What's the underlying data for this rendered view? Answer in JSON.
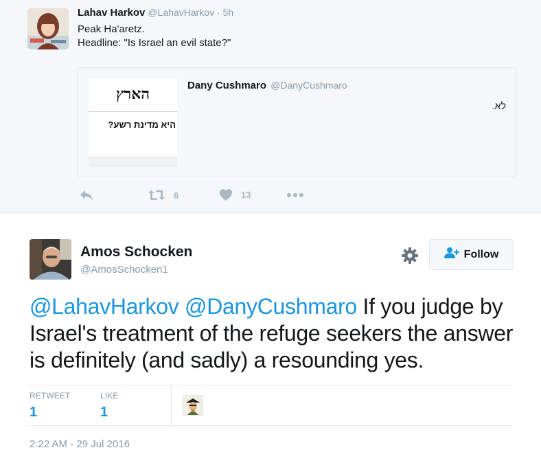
{
  "parent_tweet": {
    "author_name": "Lahav Harkov",
    "author_handle": "@LahavHarkov · 5h",
    "text_lines": [
      "Peak Ha'aretz.",
      "Headline: \"Is Israel an evil state?\""
    ],
    "quoted": {
      "author_name": "Dany Cushmaro",
      "author_handle": "@DanyCushmaro",
      "text": "לא.",
      "image_masthead": "הארץ",
      "image_headline": "היא מדינת רשע?"
    },
    "actions": {
      "reply_icon": "reply-icon",
      "retweet_icon": "retweet-icon",
      "retweet_count": "6",
      "like_icon": "heart-icon",
      "like_count": "13",
      "more_icon": "more-icon"
    }
  },
  "main_tweet": {
    "author_name": "Amos Schocken",
    "author_handle": "@AmosSchocken1",
    "follow_label": "Follow",
    "mention_1": "@LahavHarkov",
    "mention_2": "@DanyCushmaro",
    "text": "If you judge by Israel's treatment of the refuge seekers the answer is definitely (and sadly) a resounding yes.",
    "stats": {
      "retweet_label": "RETWEET",
      "retweet_value": "1",
      "like_label": "LIKE",
      "like_value": "1"
    },
    "timestamp": "2:22 AM - 29 Jul 2016"
  },
  "colors": {
    "accent": "#1b95e0",
    "muted": "#8899a6",
    "border": "#e1e8ed",
    "background_light": "#f5f8fa"
  }
}
